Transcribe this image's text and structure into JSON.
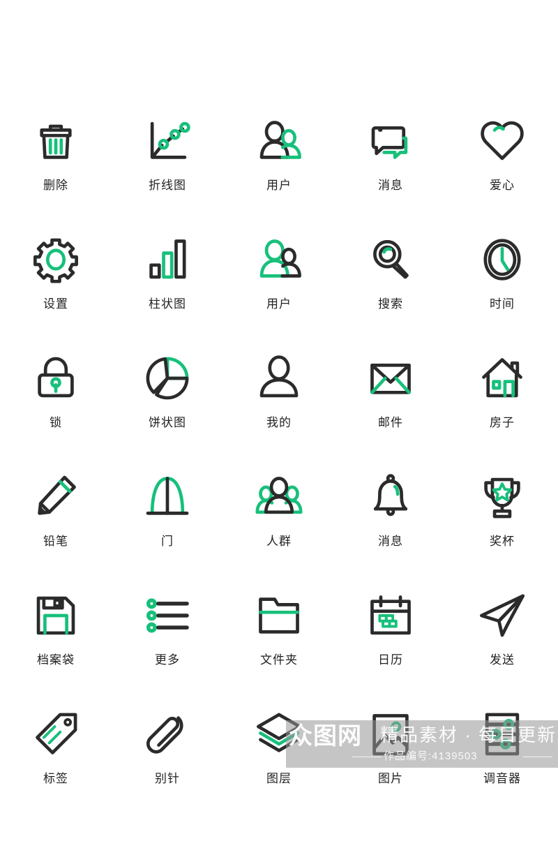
{
  "page": {
    "background": "#ffffff",
    "colors": {
      "dark": "#2b2b2b",
      "accent": "#17c07b"
    },
    "columns": 5,
    "rows": 6
  },
  "icons": [
    {
      "id": "delete",
      "icon": "trash-icon",
      "label": "删除"
    },
    {
      "id": "line-chart",
      "icon": "line-chart-icon",
      "label": "折线图"
    },
    {
      "id": "user",
      "icon": "users-pair-icon",
      "label": "用户"
    },
    {
      "id": "message",
      "icon": "chat-bubbles-icon",
      "label": "消息"
    },
    {
      "id": "heart",
      "icon": "heart-icon",
      "label": "爱心"
    },
    {
      "id": "settings",
      "icon": "gear-icon",
      "label": "设置"
    },
    {
      "id": "bar-chart",
      "icon": "bar-chart-icon",
      "label": "柱状图"
    },
    {
      "id": "user-2",
      "icon": "users-pair-alt-icon",
      "label": "用户"
    },
    {
      "id": "search",
      "icon": "magnifier-icon",
      "label": "搜索"
    },
    {
      "id": "time",
      "icon": "clock-icon",
      "label": "时间"
    },
    {
      "id": "lock",
      "icon": "lock-icon",
      "label": "锁"
    },
    {
      "id": "pie-chart",
      "icon": "pie-chart-icon",
      "label": "饼状图"
    },
    {
      "id": "mine",
      "icon": "person-icon",
      "label": "我的"
    },
    {
      "id": "mail",
      "icon": "envelope-icon",
      "label": "邮件"
    },
    {
      "id": "house",
      "icon": "house-icon",
      "label": "房子"
    },
    {
      "id": "pencil",
      "icon": "pencil-icon",
      "label": "铅笔"
    },
    {
      "id": "door",
      "icon": "door-arch-icon",
      "label": "门"
    },
    {
      "id": "crowd",
      "icon": "crowd-icon",
      "label": "人群"
    },
    {
      "id": "notify",
      "icon": "bell-icon",
      "label": "消息"
    },
    {
      "id": "trophy",
      "icon": "trophy-icon",
      "label": "奖杯"
    },
    {
      "id": "save",
      "icon": "floppy-disk-icon",
      "label": "档案袋"
    },
    {
      "id": "more",
      "icon": "list-dots-icon",
      "label": "更多"
    },
    {
      "id": "folder",
      "icon": "folder-icon",
      "label": "文件夹"
    },
    {
      "id": "calendar",
      "icon": "calendar-icon",
      "label": "日历"
    },
    {
      "id": "send",
      "icon": "paper-plane-icon",
      "label": "发送"
    },
    {
      "id": "tag",
      "icon": "tag-icon",
      "label": "标签"
    },
    {
      "id": "pin",
      "icon": "paperclip-icon",
      "label": "别针"
    },
    {
      "id": "layers",
      "icon": "layers-icon",
      "label": "图层"
    },
    {
      "id": "image",
      "icon": "picture-icon",
      "label": "图片"
    },
    {
      "id": "equalizer",
      "icon": "equalizer-icon",
      "label": "调音器"
    }
  ],
  "watermark": {
    "logo": "众图网",
    "tagline": "精品素材 · 每日更新",
    "work_id": "作品编号:4139503"
  }
}
